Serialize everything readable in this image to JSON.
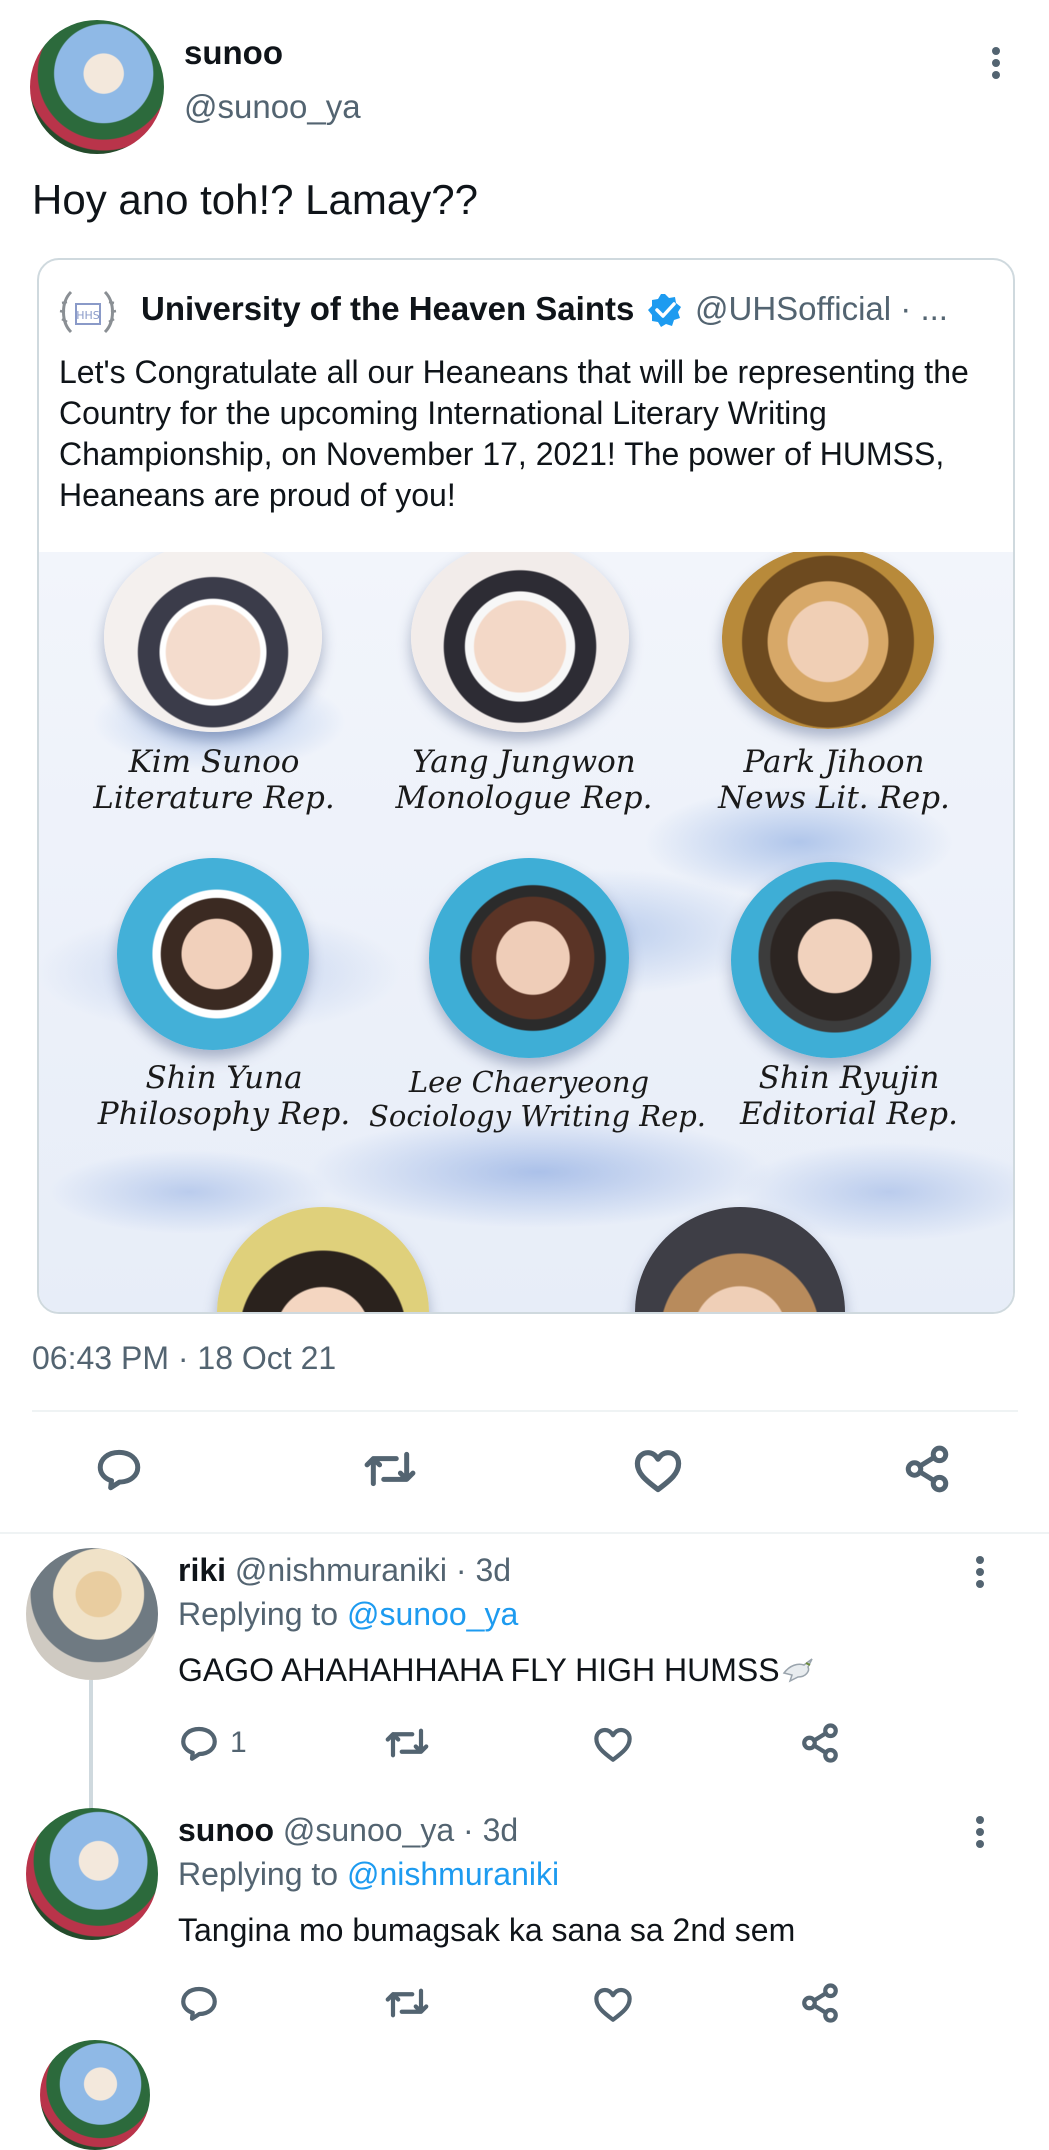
{
  "main_tweet": {
    "author_name": "sunoo",
    "author_handle": "@sunoo_ya",
    "text": "Hoy ano toh!? Lamay??",
    "timestamp": "06:43 PM · 18 Oct 21"
  },
  "quoted_tweet": {
    "author_name": "University of the Heaven Saints",
    "author_handle": "@UHSofficial · ...",
    "text": "Let's Congratulate all our Heaneans that will be representing the Country for the upcoming International Literary Writing Championship, on November 17, 2021! The power of HUMSS, Heaneans are proud of you!",
    "logo_text": "HHS",
    "poster": {
      "people": [
        {
          "name": "Kim Sunoo",
          "role": "Literature Rep."
        },
        {
          "name": "Yang Jungwon",
          "role": "Monologue Rep."
        },
        {
          "name": "Park Jihoon",
          "role": "News Lit. Rep."
        },
        {
          "name": "Shin Yuna",
          "role": "Philosophy Rep."
        },
        {
          "name": "Lee Chaeryeong",
          "role": "Sociology Writing Rep."
        },
        {
          "name": "Shin Ryujin",
          "role": "Editorial Rep."
        }
      ]
    }
  },
  "replies": [
    {
      "author_name": "riki",
      "author_handle": "@nishmuraniki · 3d",
      "replying_prefix": "Replying to",
      "replying_to": "@sunoo_ya",
      "text": "GAGO AHAHAHHAHA FLY HIGH HUMSS",
      "reply_count": "1"
    },
    {
      "author_name": "sunoo",
      "author_handle": "@sunoo_ya · 3d",
      "replying_prefix": "Replying to",
      "replying_to": "@nishmuraniki",
      "text": "Tangina mo bumagsak ka sana sa 2nd sem",
      "reply_count": ""
    }
  ],
  "colors": {
    "accent": "#1d9bf0",
    "text_secondary": "#536471",
    "border": "#cfd9de"
  }
}
